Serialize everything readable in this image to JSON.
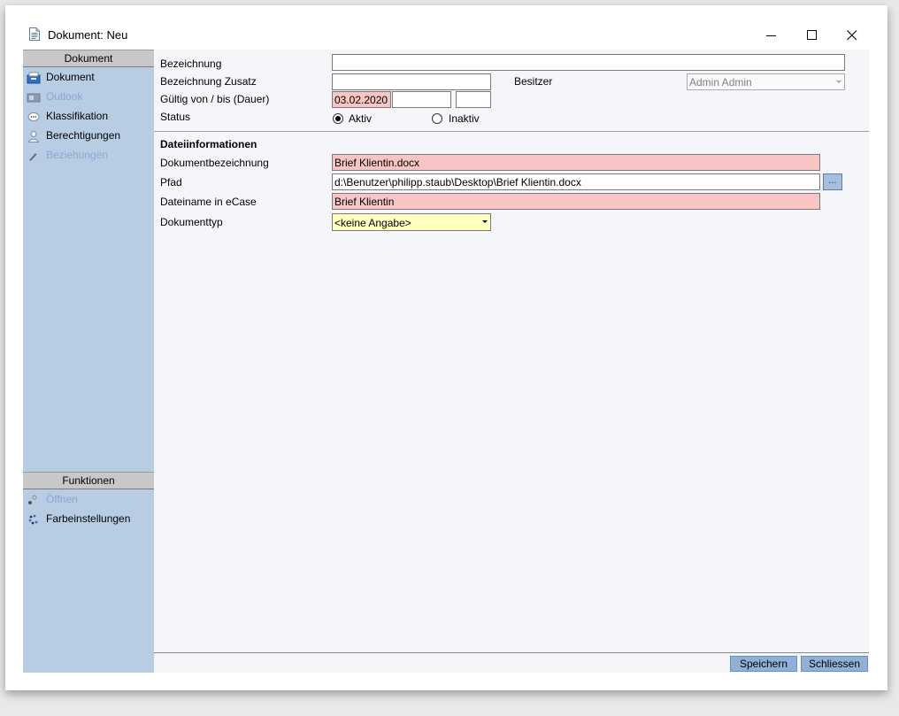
{
  "window": {
    "title": "Dokument: Neu"
  },
  "sidebar": {
    "section1_title": "Dokument",
    "items": [
      {
        "label": "Dokument",
        "icon": "document-drawer-icon",
        "enabled": true
      },
      {
        "label": "Outlook",
        "icon": "outlook-icon",
        "enabled": false
      },
      {
        "label": "Klassifikation",
        "icon": "classification-icon",
        "enabled": true
      },
      {
        "label": "Berechtigungen",
        "icon": "user-permission-icon",
        "enabled": true
      },
      {
        "label": "Beziehungen",
        "icon": "pencil-icon",
        "enabled": false
      }
    ],
    "section2_title": "Funktionen",
    "functions": [
      {
        "label": "Öffnen",
        "icon": "open-icon",
        "enabled": false
      },
      {
        "label": "Farbeinstellungen",
        "icon": "color-palette-icon",
        "enabled": true
      }
    ]
  },
  "form": {
    "bezeichnung_label": "Bezeichnung",
    "bezeichnung_value": "",
    "zusatz_label": "Bezeichnung Zusatz",
    "zusatz_value": "",
    "besitzer_label": "Besitzer",
    "besitzer_value": "Admin Admin",
    "gueltig_label": "Gültig von / bis (Dauer)",
    "gueltig_von": "03.02.2020",
    "gueltig_bis": "",
    "dauer": "",
    "status_label": "Status",
    "status_options": [
      "Aktiv",
      "Inaktiv"
    ],
    "status_selected": "Aktiv"
  },
  "datei": {
    "section_title": "Dateiinformationen",
    "dokumentbezeichnung_label": "Dokumentbezeichnung",
    "dokumentbezeichnung_value": "Brief Klientin.docx",
    "pfad_label": "Pfad",
    "pfad_value": "d:\\Benutzer\\philipp.staub\\Desktop\\Brief Klientin.docx",
    "browse_label": "...",
    "dateiname_label": "Dateiname in eCase",
    "dateiname_value": "Brief Klientin",
    "dokumenttyp_label": "Dokumenttyp",
    "dokumenttyp_value": "<keine Angabe>"
  },
  "footer": {
    "save_label": "Speichern",
    "close_label": "Schliessen"
  },
  "colors": {
    "sidebar_bg": "#b8cce4",
    "required_field": "#f8c4c4",
    "dropdown_field": "#ffffc0",
    "button_bg": "#8fb1d8",
    "disabled_text": "#8ba8cf"
  }
}
